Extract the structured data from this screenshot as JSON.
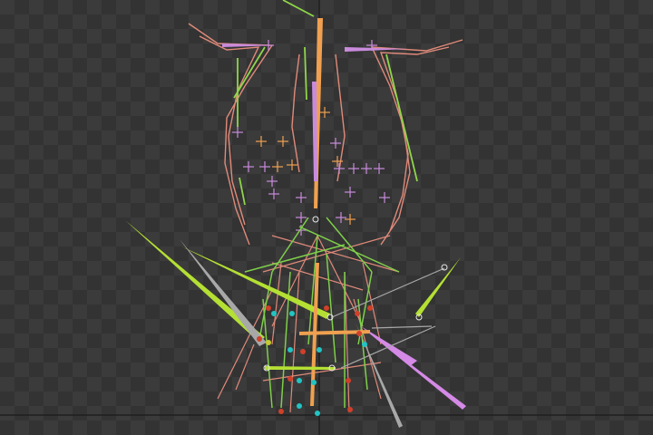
{
  "viewport": {
    "checker_light": "#3b3b3b",
    "checker_dark": "#333333",
    "axis_color": "#1f1f1f"
  },
  "bone_colors": {
    "lime": "#a6e22e",
    "green": "#6fd26f",
    "salmon": "#e08a7a",
    "orange": "#f0a050",
    "violet": "#c98bdc",
    "grey": "#a8a8a8",
    "pink": "#e6a0c4"
  },
  "joint_colors": {
    "red": "#d0402a",
    "cyan": "#22c4c4",
    "yellow": "#c8c830",
    "white": "#e8e8e8"
  },
  "marker_icons": {
    "control": "crosshair-icon",
    "joint": "joint-dot-icon"
  }
}
